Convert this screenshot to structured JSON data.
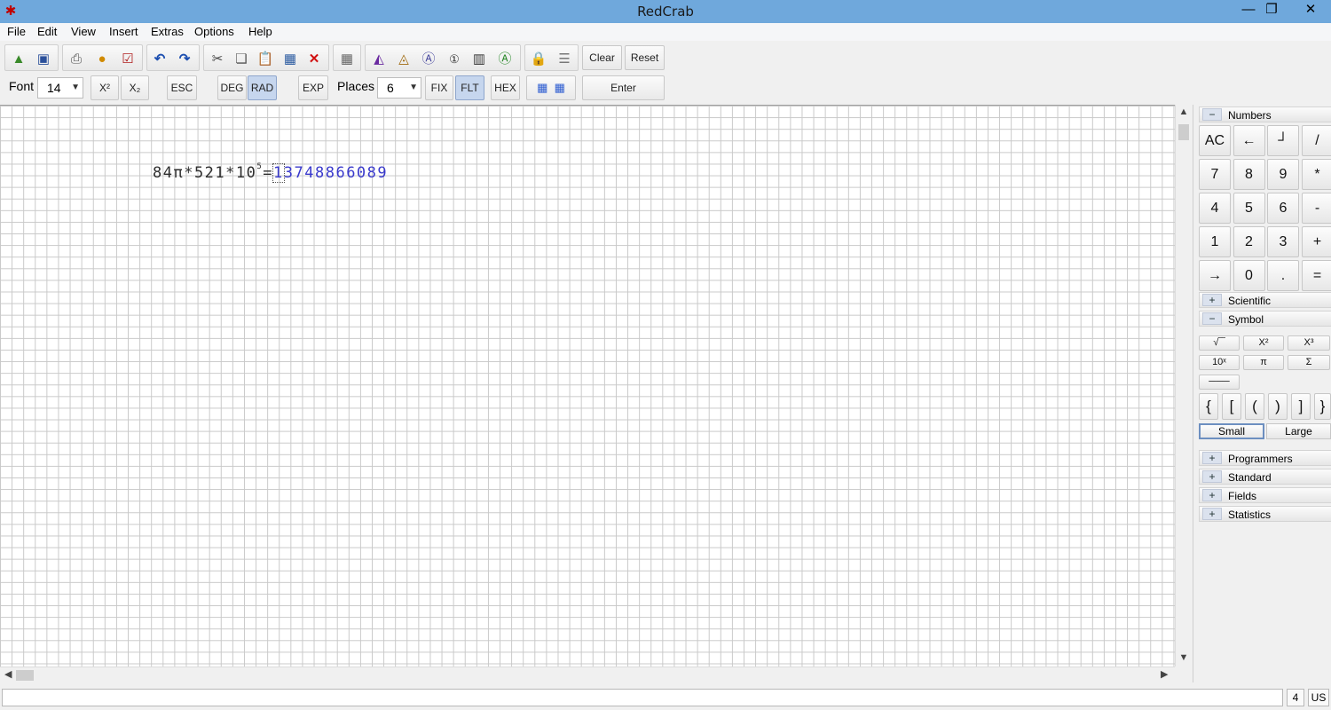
{
  "window": {
    "title": "RedCrab",
    "controls": {
      "minimize": "—",
      "restore": "❐",
      "close": "✕"
    }
  },
  "menu": [
    "File",
    "Edit",
    "View",
    "Insert",
    "Extras",
    "Options",
    "Help"
  ],
  "toolbar1": {
    "icons": [
      "open-icon",
      "save-icon",
      "print-icon",
      "paint-icon",
      "check-icon",
      "undo-icon",
      "redo-icon",
      "cut-icon",
      "copy-icon",
      "paste-icon",
      "table-icon",
      "delete-icon",
      "grid-icon",
      "chart-icon",
      "chart-a-icon",
      "text-a-icon",
      "number-1-icon",
      "bar-chart-icon",
      "green-a-icon",
      "lock-icon",
      "lines-icon"
    ],
    "clear_label": "Clear",
    "reset_label": "Reset"
  },
  "toolbar2": {
    "font_label": "Font",
    "font_size": "14",
    "superscript_label": "X²",
    "subscript_label": "X₂",
    "esc_label": "ESC",
    "deg_label": "DEG",
    "rad_label": "RAD",
    "exp_label": "EXP",
    "places_label": "Places",
    "places_value": "6",
    "fix_label": "FIX",
    "flt_label": "FLT",
    "hex_label": "HEX",
    "enter_label": "Enter",
    "active": [
      "RAD",
      "FLT"
    ]
  },
  "worksheet": {
    "expression_prefix": "84π*521*10",
    "exponent": "5",
    "equals": "=",
    "result_first": "1",
    "result_rest": "3748866089"
  },
  "panel": {
    "numbers": {
      "header": "Numbers",
      "toggle": "−",
      "keys": [
        "AC",
        "←",
        "┘",
        "/",
        "7",
        "8",
        "9",
        "*",
        "4",
        "5",
        "6",
        "-",
        "1",
        "2",
        "3",
        "+",
        "→",
        "0",
        ".",
        "="
      ]
    },
    "scientific": {
      "header": "Scientific",
      "toggle": "+"
    },
    "symbol": {
      "header": "Symbol",
      "toggle": "−",
      "row1": [
        "√‾‾",
        "X²",
        "X³"
      ],
      "row2": [
        "10ˣ",
        "π",
        "Σ"
      ],
      "fraction": "───",
      "brackets": [
        "{",
        "[",
        "(",
        ")",
        "]",
        "}"
      ],
      "small": "Small",
      "large": "Large"
    },
    "collapsed": [
      {
        "header": "Programmers",
        "toggle": "+"
      },
      {
        "header": "Standard",
        "toggle": "+"
      },
      {
        "header": "Fields",
        "toggle": "+"
      },
      {
        "header": "Statistics",
        "toggle": "+"
      }
    ]
  },
  "statusbar": {
    "cell1": "4",
    "cell2": "US"
  },
  "colors": {
    "titlebar": "#6fa8dc",
    "result": "#3a3acc",
    "active_button": "#c6d6ee"
  }
}
